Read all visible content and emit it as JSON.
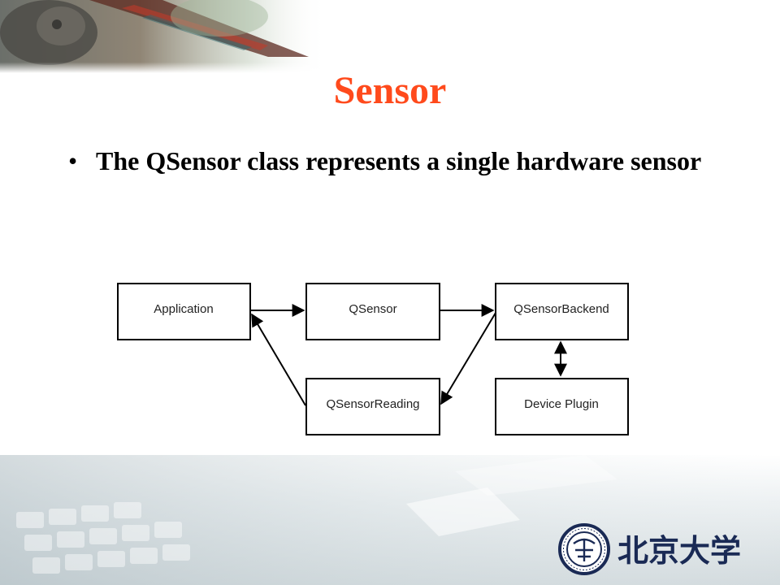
{
  "slide": {
    "title": "Sensor",
    "bullets": [
      "The QSensor class represents a single hardware sensor"
    ]
  },
  "diagram": {
    "nodes": [
      {
        "id": "application",
        "label": "Application"
      },
      {
        "id": "qsensor",
        "label": "QSensor"
      },
      {
        "id": "qsensorbackend",
        "label": "QSensorBackend"
      },
      {
        "id": "qsensorreading",
        "label": "QSensorReading"
      },
      {
        "id": "deviceplugin",
        "label": "Device Plugin"
      }
    ],
    "edges": [
      {
        "from": "application",
        "to": "qsensor",
        "direction": "forward"
      },
      {
        "from": "qsensor",
        "to": "qsensorbackend",
        "direction": "forward"
      },
      {
        "from": "qsensorbackend",
        "to": "qsensorreading",
        "direction": "forward"
      },
      {
        "from": "qsensorreading",
        "to": "application",
        "direction": "forward"
      },
      {
        "from": "qsensorbackend",
        "to": "deviceplugin",
        "direction": "both"
      }
    ]
  },
  "colors": {
    "title": "#ff4a1c",
    "text": "#000000",
    "box_stroke": "#000000"
  },
  "branding": {
    "logo_icon": "peking-university-seal-icon",
    "logo_wordmark": "北京大学"
  }
}
